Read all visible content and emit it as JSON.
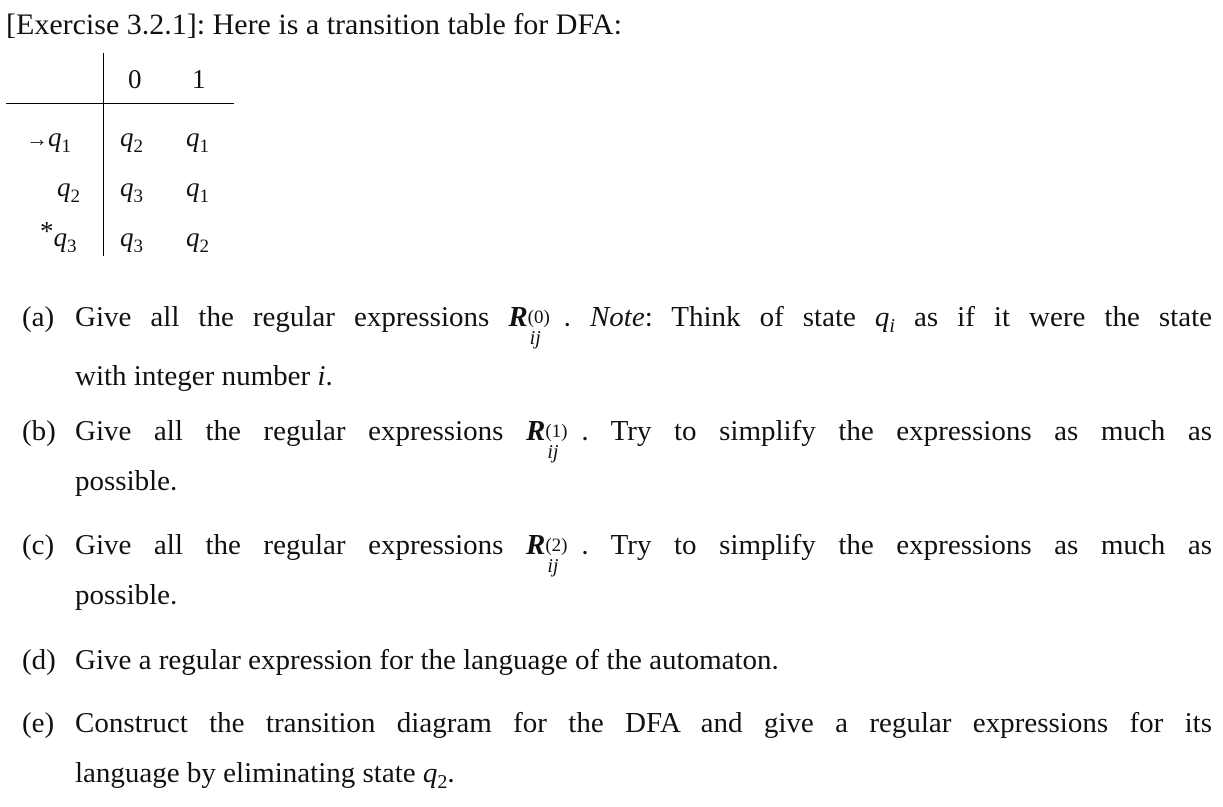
{
  "heading": "[Exercise 3.2.1]: Here is a transition table for DFA:",
  "table": {
    "columns": [
      "0",
      "1"
    ],
    "rows": [
      {
        "marker": "→",
        "state": "q",
        "state_sub": "1",
        "on0": "q",
        "on0_sub": "2",
        "on1": "q",
        "on1_sub": "1"
      },
      {
        "marker": "",
        "state": "q",
        "state_sub": "2",
        "on0": "q",
        "on0_sub": "3",
        "on1": "q",
        "on1_sub": "1"
      },
      {
        "marker": "*",
        "state": "q",
        "state_sub": "3",
        "on0": "q",
        "on0_sub": "3",
        "on1": "q",
        "on1_sub": "2"
      }
    ]
  },
  "items": {
    "a": {
      "label": "(a)",
      "pre": "Give all the regular expressions ",
      "r": "R",
      "sup": "(0)",
      "sub": "ij",
      "note_dot": ". ",
      "note_word": "Note",
      "post1": ": Think of state ",
      "q": "q",
      "qsub": "i",
      "post2": " as if it were the state",
      "line2_pre": "with integer number ",
      "line2_i": "i",
      "line2_end": "."
    },
    "b": {
      "label": "(b)",
      "pre": "Give all the regular expressions ",
      "r": "R",
      "sup": "(1)",
      "sub": "ij",
      "post": ". Try to simplify the expressions as much as",
      "line2": "possible."
    },
    "c": {
      "label": "(c)",
      "pre": "Give all the regular expressions ",
      "r": "R",
      "sup": "(2)",
      "sub": "ij",
      "post": ". Try to simplify the expressions as much as",
      "line2": "possible."
    },
    "d": {
      "label": "(d)",
      "text": "Give a regular expression for the language of the automaton."
    },
    "e": {
      "label": "(e)",
      "line1": "Construct the transition diagram for the DFA and give a regular expressions for its",
      "line2_pre": "language by eliminating state ",
      "q": "q",
      "qsub": "2",
      "line2_end": "."
    }
  }
}
